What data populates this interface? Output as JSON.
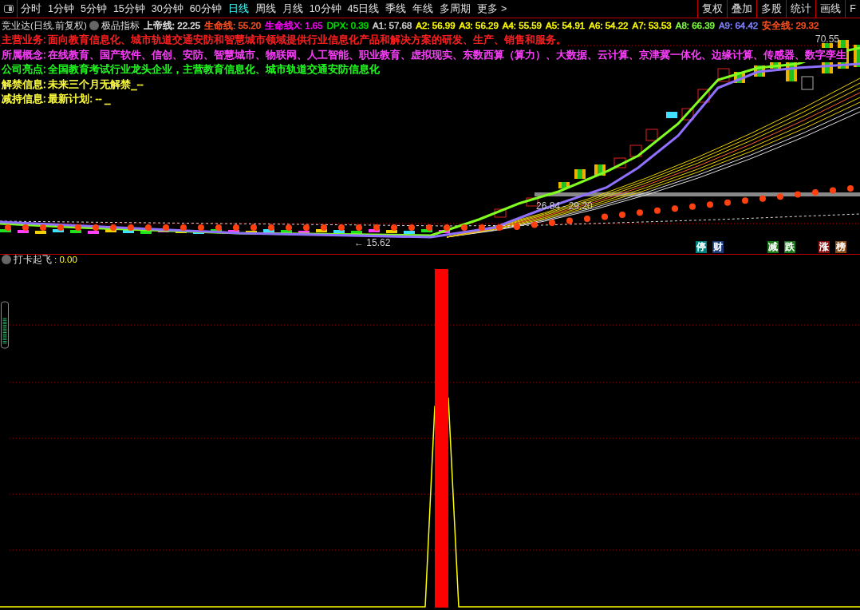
{
  "toolbar": {
    "periods": [
      {
        "label": "分时",
        "selected": false
      },
      {
        "label": "1分钟",
        "selected": false
      },
      {
        "label": "5分钟",
        "selected": false
      },
      {
        "label": "15分钟",
        "selected": false
      },
      {
        "label": "30分钟",
        "selected": false
      },
      {
        "label": "60分钟",
        "selected": false
      },
      {
        "label": "日线",
        "selected": true
      },
      {
        "label": "周线",
        "selected": false
      },
      {
        "label": "月线",
        "selected": false
      },
      {
        "label": "10分钟",
        "selected": false
      },
      {
        "label": "45日线",
        "selected": false
      },
      {
        "label": "季线",
        "selected": false
      },
      {
        "label": "年线",
        "selected": false
      },
      {
        "label": "多周期",
        "selected": false
      }
    ],
    "more": "更多 >",
    "tools": [
      "复权",
      "叠加",
      "多股",
      "统计",
      "画线",
      "F"
    ]
  },
  "price_panel": {
    "stock": "竞业达(日线.前复权)",
    "indicator": "极品指标",
    "values": [
      {
        "text": "上帝线: 22.25",
        "color": "#e0e0e0"
      },
      {
        "text": "生命线: 55.20",
        "color": "#ff5020"
      },
      {
        "text": "生命线X: 1.65",
        "color": "#ff00ff"
      },
      {
        "text": "DPX: 0.39",
        "color": "#00e000"
      },
      {
        "text": "A1: 57.68",
        "color": "#d0d0d0"
      },
      {
        "text": "A2: 56.99",
        "color": "#ffff00"
      },
      {
        "text": "A3: 56.29",
        "color": "#ffff00"
      },
      {
        "text": "A4: 55.59",
        "color": "#ffff00"
      },
      {
        "text": "A5: 54.91",
        "color": "#ffff00"
      },
      {
        "text": "A6: 54.22",
        "color": "#ffff00"
      },
      {
        "text": "A7: 53.53",
        "color": "#ffff00"
      },
      {
        "text": "A8: 66.39",
        "color": "#80ff40"
      },
      {
        "text": "A9: 64.42",
        "color": "#8080ff"
      },
      {
        "text": "安全线: 29.32",
        "color": "#ff5020"
      }
    ],
    "info": [
      {
        "label": "主营业务:",
        "text": "面向教育信息化、城市轨道交通安防和智慧城市领域提供行业信息化产品和解决方案的研发、生产、销售和服务。",
        "color": "#ff2020"
      },
      {
        "label": "所属概念:",
        "text": "在线教育、国产软件、信创、安防、智慧城市、物联网、人工智能、职业教育、虚拟现实、东数西算（算力）、大数据、云计算、京津冀一体化、边缘计算、传感器、数字孪生",
        "color": "#ff40ff"
      },
      {
        "label": "公司亮点:",
        "text": "全国教育考试行业龙头企业，主营教育信息化、城市轨道交通安防信息化",
        "color": "#20ff20"
      },
      {
        "label": "解禁信息:",
        "text": "未来三个月无解禁_--",
        "color": "#ffff40"
      },
      {
        "label": "减持信息:",
        "text": "最新计划: -- _",
        "color": "#ffff40"
      }
    ],
    "high_label": "70.55",
    "range_label": "26.84 - 29.20",
    "low_label": "← 15.62",
    "signals": [
      {
        "text": "停",
        "color": "#007f7f"
      },
      {
        "text": "财",
        "color": "#1a3a7a"
      },
      {
        "text": "减",
        "color": "#1a7a1a"
      },
      {
        "text": "跌",
        "color": "#1a7a1a"
      },
      {
        "text": "涨",
        "color": "#8b1010"
      },
      {
        "text": "榜",
        "color": "#8b4a13"
      }
    ]
  },
  "signal_panel": {
    "title": "打卡起飞",
    "value": ": 0.00"
  }
}
